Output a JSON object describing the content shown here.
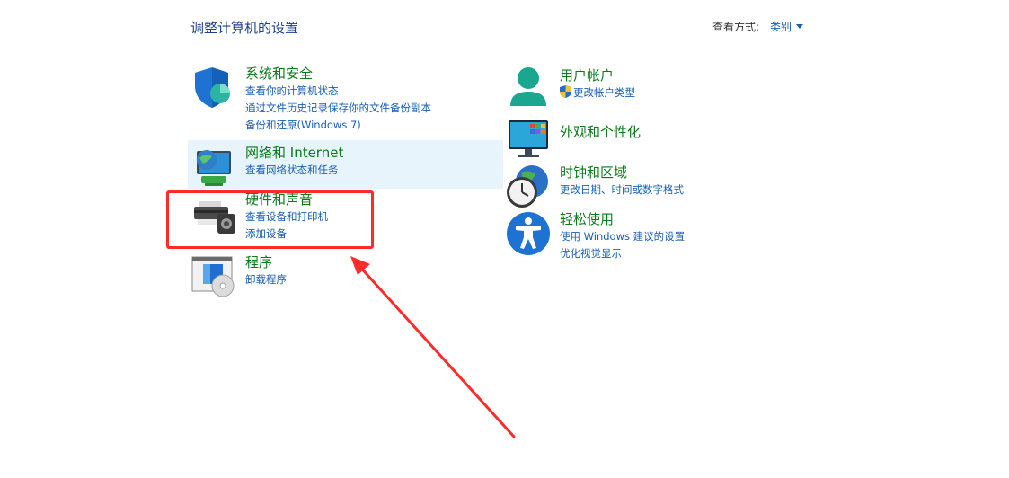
{
  "header": {
    "title": "调整计算机的设置",
    "view_by_label": "查看方式:",
    "view_by_value": "类别"
  },
  "categories_left": [
    {
      "title": "系统和安全",
      "links": [
        "查看你的计算机状态",
        "通过文件历史记录保存你的文件备份副本",
        "备份和还原(Windows 7)"
      ]
    },
    {
      "title": "网络和 Internet",
      "links": [
        "查看网络状态和任务"
      ]
    },
    {
      "title": "硬件和声音",
      "links": [
        "查看设备和打印机",
        "添加设备"
      ]
    },
    {
      "title": "程序",
      "links": [
        "卸载程序"
      ]
    }
  ],
  "categories_right": [
    {
      "title": "用户帐户",
      "links": [
        "更改帐户类型"
      ]
    },
    {
      "title": "外观和个性化",
      "links": []
    },
    {
      "title": "时钟和区域",
      "links": [
        "更改日期、时间或数字格式"
      ]
    },
    {
      "title": "轻松使用",
      "links": [
        "使用 Windows 建议的设置",
        "优化视觉显示"
      ]
    }
  ],
  "colors": {
    "title_green": "#0a7a1a",
    "link_blue": "#1a5fb4",
    "annotation_red": "#ff2a2a",
    "hover_bg": "#e8f4fc"
  }
}
